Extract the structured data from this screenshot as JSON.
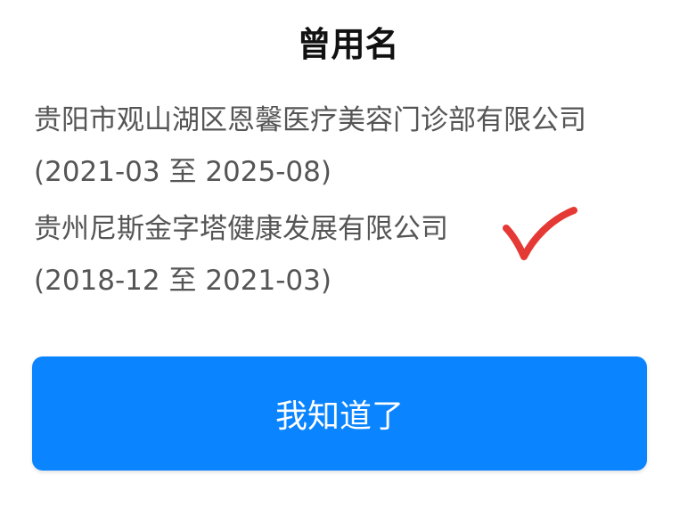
{
  "dialog": {
    "title": "曾用名",
    "entries": [
      {
        "company": "贵阳市观山湖区恩馨医疗美容门诊部有限公司",
        "period": "(2021-03 至 2025-08)"
      },
      {
        "company": "贵州尼斯金字塔健康发展有限公司",
        "period": "(2018-12 至 2021-03)"
      }
    ],
    "button_label": "我知道了",
    "accent_color": "#0a84ff",
    "check_mark_color": "#e53935",
    "check_mark_icon": "red-check-mark-icon"
  }
}
